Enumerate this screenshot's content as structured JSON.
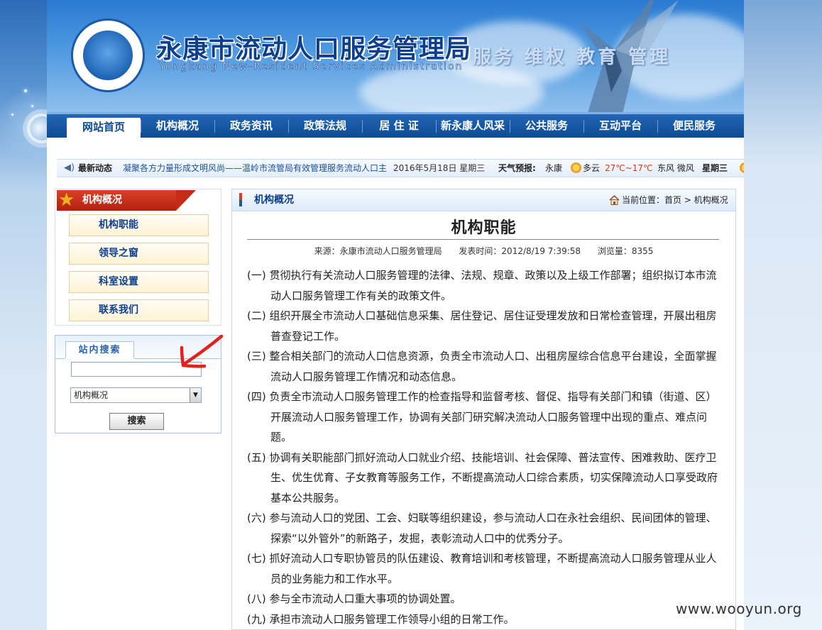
{
  "banner": {
    "title": "永康市流动人口服务管理局",
    "subtitle": "Yongkang New-Resident Services Administration",
    "slogan": "服务 维权 教育 管理"
  },
  "nav": {
    "items": [
      "网站首页",
      "机构概况",
      "政务资讯",
      "政策法规",
      "居 住 证",
      "新永康人风采",
      "公共服务",
      "互动平台",
      "便民服务"
    ],
    "active": "网站首页"
  },
  "ticker": {
    "label": "最新动态",
    "news": "凝聚各方力量形成文明风尚——温岭市流管局有效管理服务流动人口主",
    "date": "2016年5月18日 星期三",
    "weather_label": "天气预报:",
    "city": "永康",
    "condition": "多云",
    "temperature": "27℃~17℃",
    "wind": "东风 微风",
    "day": "星期三"
  },
  "sidebar": {
    "heading": "机构概况",
    "items": [
      "机构职能",
      "领导之窗",
      "科室设置",
      "联系我们"
    ]
  },
  "search": {
    "tab_label": "站内搜索",
    "input_value": "",
    "select_value": "机构概况",
    "button_label": "搜索"
  },
  "content": {
    "bar_title": "机构概况",
    "breadcrumb": "当前位置：首页 > 机构概况",
    "article_title": "机构职能",
    "source": "来源：永康市流动人口服务管理局",
    "publish_time": "发表时间：2012/8/19 7:39:58",
    "views": "浏览量：8355",
    "paragraphs": [
      "(一) 贯彻执行有关流动人口服务管理的法律、法规、规章、政策以及上级工作部署；组织拟订本市流动人口服务管理工作有关的政策文件。",
      "(二) 组织开展全市流动人口基础信息采集、居住登记、居住证受理发放和日常检查管理，开展出租房普查登记工作。",
      "(三) 整合相关部门的流动人口信息资源，负责全市流动人口、出租房屋综合信息平台建设，全面掌握流动人口服务管理工作情况和动态信息。",
      "(四) 负责全市流动人口服务管理工作的检查指导和监督考核、督促、指导有关部门和镇（街道、区）开展流动人口服务管理工作，协调有关部门研究解决流动人口服务管理中出现的重点、难点问题。",
      "(五) 协调有关职能部门抓好流动人口就业介绍、技能培训、社会保障、普法宣传、困难救助、医疗卫生、优生优育、子女教育等服务工作，不断提高流动人口综合素质，切实保障流动人口享受政府基本公共服务。",
      "(六) 参与流动人口的党团、工会、妇联等组织建设，参与流动人口在永社会组织、民间团体的管理、探索“以外管外”的新路子，发掘，表彰流动人口中的优秀分子。",
      "(七) 抓好流动人口专职协管员的队伍建设、教育培训和考核管理，不断提高流动人口服务管理从业人员的业务能力和工作水平。",
      "(八) 参与全市流动人口重大事项的协调处置。",
      "(九) 承担市流动人口服务管理工作领导小组的日常工作。"
    ]
  },
  "watermark": "www.wooyun.org",
  "colors": {
    "nav_bg": "#0e4b93",
    "title_blue": "#0d3f8e",
    "sidebar_head_red": "#c52b16",
    "annotation_red": "#e0241b"
  },
  "icons": [
    "speaker-icon",
    "sun-icon",
    "star-icon",
    "home-icon",
    "dropdown-arrow-icon",
    "red-arrow-annotation"
  ]
}
